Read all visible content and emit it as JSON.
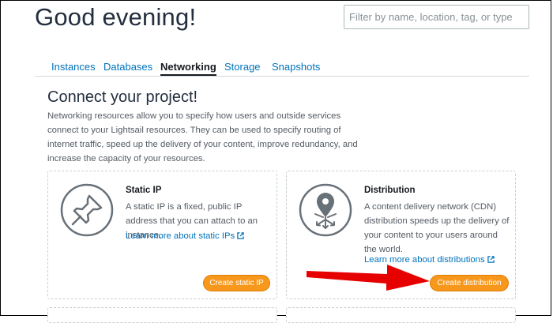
{
  "greeting": "Good evening!",
  "search": {
    "placeholder": "Filter by name, location, tag, or type"
  },
  "tabs": [
    {
      "label": "Instances",
      "active": false
    },
    {
      "label": "Databases",
      "active": false
    },
    {
      "label": "Networking",
      "active": true
    },
    {
      "label": "Storage",
      "active": false
    },
    {
      "label": "Snapshots",
      "active": false
    }
  ],
  "section": {
    "heading": "Connect your project!",
    "intro": "Networking resources allow you to specify how users and outside services connect to your Lightsail resources. They can be used to specify routing of internet traffic, speed up the delivery of your content, improve redundancy, and increase the capacity of your resources."
  },
  "cards": {
    "static_ip": {
      "title": "Static IP",
      "description": "A static IP is a fixed, public IP address that you can attach to an instance.",
      "link": "Learn more about static IPs",
      "button": "Create static IP",
      "icon": "pushpin-icon"
    },
    "distribution": {
      "title": "Distribution",
      "description": "A content delivery network (CDN) distribution speeds up the delivery of your content to your users around the world.",
      "link": "Learn more about distributions",
      "button": "Create distribution",
      "icon": "cdn-distribution-icon"
    }
  },
  "colors": {
    "link": "#0073bb",
    "button": "#f7981d",
    "annotation_arrow": "#e60000"
  }
}
